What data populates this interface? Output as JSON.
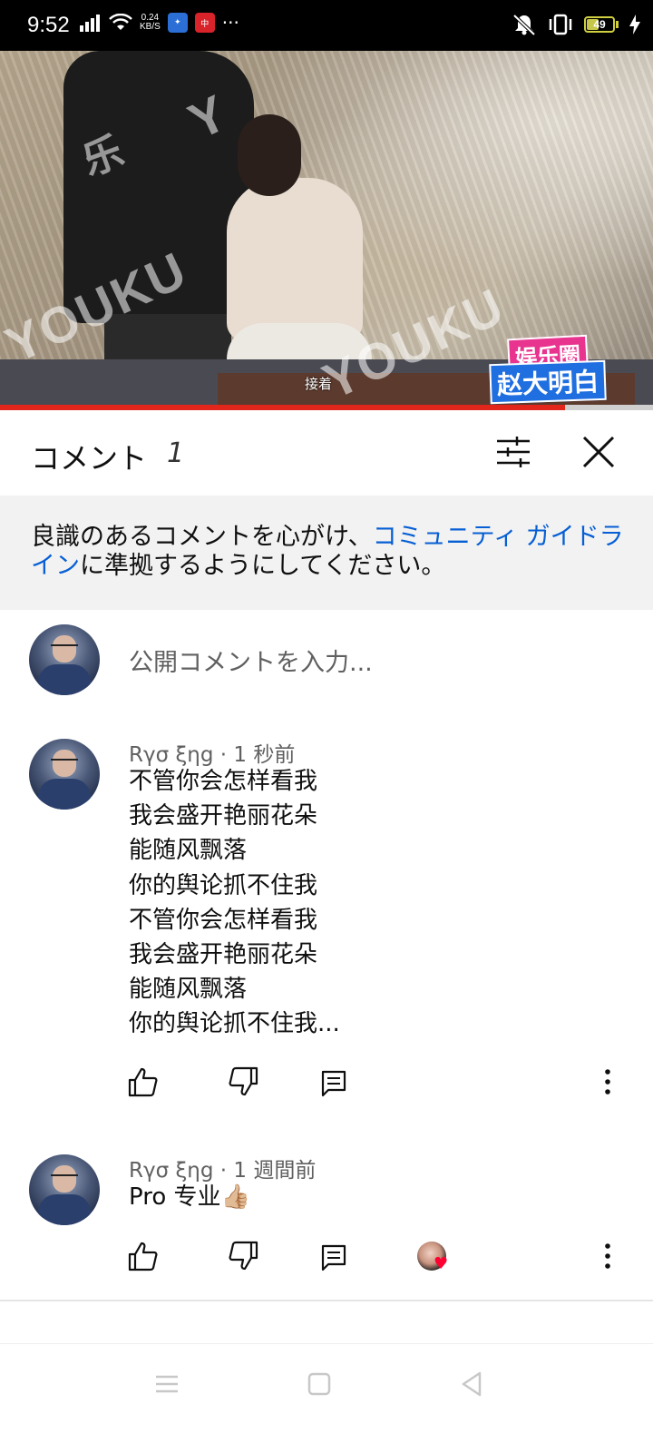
{
  "status_bar": {
    "time": "9:52",
    "net_speed_value": "0.24",
    "net_speed_unit": "KB/S",
    "more": "···",
    "battery_level": "49",
    "battery_fraction": 0.49
  },
  "video": {
    "subtitle": "接着",
    "watermark_1": "乐",
    "watermark_2": "YOUKU",
    "watermark_3": "YOUKU",
    "watermark_4": "Y",
    "logo_top": "娱乐圈",
    "logo_bottom": "赵大明白",
    "progress_fraction": 0.865,
    "progress_color": "#e3261c"
  },
  "comments_panel": {
    "title": "コメント",
    "count": "1",
    "notice_text_before": "良識のあるコメントを心がけ、",
    "notice_link": "コミュニティ ガイドライン",
    "notice_text_after": "に準拠するようにしてください。",
    "input_placeholder": "公開コメントを入力...",
    "link_color": "#065fd4"
  },
  "comments": [
    {
      "author": "Rγσ ξηg",
      "time": "1 秒前",
      "body": "不管你会怎样看我\n我会盛开艳丽花朵\n能随风飘落\n你的舆论抓不住我\n不管你会怎样看我\n我会盛开艳丽花朵\n能随风飘落\n你的舆论抓不住我..."
    },
    {
      "author": "Rγσ ξηg",
      "time": "1 週間前",
      "body": "Pro 专业👍🏼"
    }
  ],
  "icons": {
    "like": "thumb-up-icon",
    "dislike": "thumb-down-icon",
    "reply": "reply-icon",
    "more": "more-vert-icon",
    "filter": "tune-icon",
    "close": "close-icon",
    "creator_heart": "heart-icon"
  }
}
